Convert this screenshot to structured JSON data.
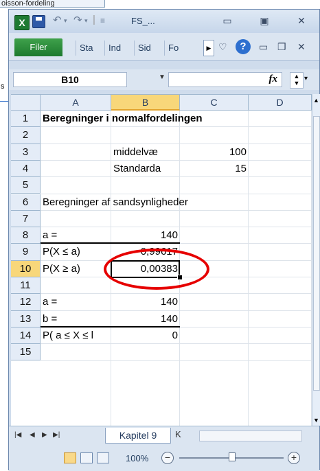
{
  "background_window": {
    "title": "oisson-fordeling",
    "side_char": "s"
  },
  "window": {
    "title": "FS_...",
    "app_logo": "X"
  },
  "ribbon": {
    "file_tab": "Filer",
    "tabs": [
      "Sta",
      "Ind",
      "Sid",
      "Fo"
    ]
  },
  "formula_bar": {
    "name_box": "B10",
    "fx_label": "fx",
    "formula": ""
  },
  "columns": [
    "A",
    "B",
    "C",
    "D"
  ],
  "selected_column": "B",
  "selected_row": "10",
  "rows": [
    {
      "num": "1",
      "A": "Beregninger i normalfordelingen",
      "B": "",
      "C": ""
    },
    {
      "num": "2",
      "A": "",
      "B": "",
      "C": ""
    },
    {
      "num": "3",
      "A": "",
      "B": "middelvæ",
      "C": "100"
    },
    {
      "num": "4",
      "A": "",
      "B": "Standarda",
      "C": "15"
    },
    {
      "num": "5",
      "A": "",
      "B": "",
      "C": ""
    },
    {
      "num": "6",
      "A": "Beregninger af sandsynligheder",
      "B": "",
      "C": ""
    },
    {
      "num": "7",
      "A": "",
      "B": "",
      "C": ""
    },
    {
      "num": "8",
      "A": "a =",
      "B": "140",
      "C": ""
    },
    {
      "num": "9",
      "A": "P(X ≤ a)",
      "B": "0,99617",
      "C": ""
    },
    {
      "num": "10",
      "A": "P(X ≥ a)",
      "B": "0,00383",
      "C": ""
    },
    {
      "num": "11",
      "A": "",
      "B": "",
      "C": ""
    },
    {
      "num": "12",
      "A": "a =",
      "B": "140",
      "C": ""
    },
    {
      "num": "13",
      "A": "b =",
      "B": "140",
      "C": ""
    },
    {
      "num": "14",
      "A": "P( a ≤ X ≤ l",
      "B": "0",
      "C": ""
    },
    {
      "num": "15",
      "A": "",
      "B": "",
      "C": ""
    }
  ],
  "sheet_tab": "Kapitel 9",
  "sheet_tab_short": "K",
  "status": {
    "zoom": "100%"
  },
  "colors": {
    "highlight": "#e60000",
    "selected_header": "#f8d77a",
    "file_tab": "#2b8a3a"
  }
}
